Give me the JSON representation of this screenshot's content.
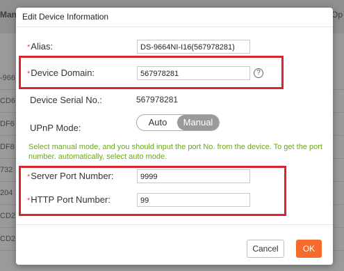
{
  "background": {
    "header_left": "Man",
    "header_right": "Op",
    "row_fragments": [
      "-966",
      "CD6",
      "DF6",
      "DF8",
      "732",
      "204",
      "CD2",
      "CD2"
    ]
  },
  "dialog": {
    "title": "Edit Device Information",
    "fields": {
      "alias": {
        "required_mark": "*",
        "label": "Alias:",
        "value": "DS-9664NI-I16(567978281)"
      },
      "device_domain": {
        "required_mark": "*",
        "label": "Device Domain:",
        "value": "567978281",
        "help": "?"
      },
      "serial": {
        "label": "Device Serial No.:",
        "value": "567978281"
      },
      "upnp": {
        "label": "UPnP Mode:",
        "options": [
          "Auto",
          "Manual"
        ],
        "selected": "Manual"
      },
      "server_port": {
        "required_mark": "*",
        "label": "Server Port Number:",
        "value": "9999"
      },
      "http_port": {
        "required_mark": "*",
        "label": "HTTP Port Number:",
        "value": "99"
      }
    },
    "note": "Select manual mode, and you should input the port No. from the device. To get the port number. automatically, select auto mode.",
    "buttons": {
      "cancel": "Cancel",
      "ok": "OK"
    }
  },
  "colors": {
    "ok_button": "#f46b2c",
    "highlight": "#d9262c",
    "note_text": "#6aa81b",
    "required": "#e74c3c"
  }
}
